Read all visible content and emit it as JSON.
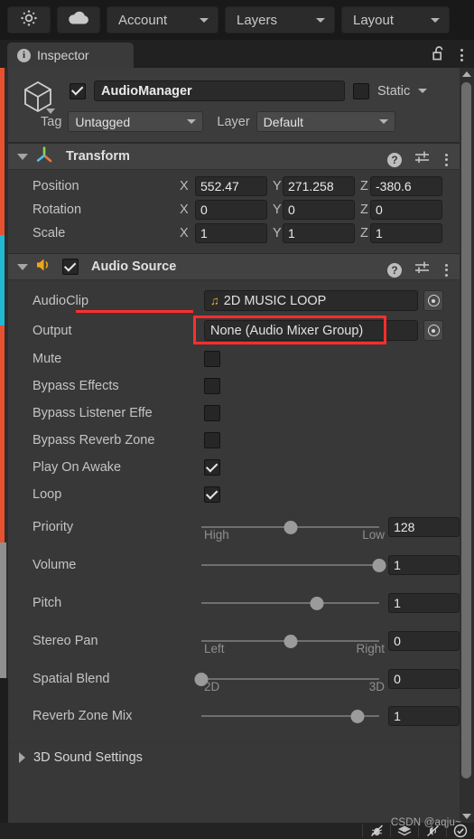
{
  "toolbar": {
    "icon_buttons": [
      {
        "name": "unity-effects-icon",
        "label": ""
      },
      {
        "name": "cloud-icon",
        "label": ""
      }
    ],
    "dropdowns": [
      {
        "label": "Account"
      },
      {
        "label": "Layers"
      },
      {
        "label": "Layout"
      }
    ]
  },
  "tab": {
    "label": "Inspector",
    "icon": "info-icon",
    "lock_icon": "unlocked-padlock-icon",
    "menu_icon": "kebab-menu-icon"
  },
  "object_header": {
    "icon": "gameobject-cube-icon",
    "enabled": true,
    "name": "AudioManager",
    "static_label": "Static",
    "static_checked": false,
    "tag_label": "Tag",
    "tag_value": "Untagged",
    "layer_label": "Layer",
    "layer_value": "Default"
  },
  "transform": {
    "title": "Transform",
    "icon": "transform-gizmo-icon",
    "expanded": true,
    "rows": [
      {
        "label": "Position",
        "x": "552.47",
        "y": "271.258",
        "z": "-380.6"
      },
      {
        "label": "Rotation",
        "x": "0",
        "y": "0",
        "z": "0"
      },
      {
        "label": "Scale",
        "x": "1",
        "y": "1",
        "z": "1"
      }
    ],
    "axes": [
      "X",
      "Y",
      "Z"
    ]
  },
  "audio_source": {
    "title": "Audio Source",
    "icon": "speaker-icon",
    "enabled": true,
    "expanded": true,
    "audio_clip": {
      "label": "AudioClip",
      "value": "2D MUSIC LOOP",
      "icon": "music-note-icon",
      "highlighted": true
    },
    "output": {
      "label": "Output",
      "value": "None (Audio Mixer Group)"
    },
    "toggles": [
      {
        "label": "Mute",
        "checked": false
      },
      {
        "label": "Bypass Effects",
        "checked": false
      },
      {
        "label": "Bypass Listener Effe",
        "checked": false
      },
      {
        "label": "Bypass Reverb Zone",
        "checked": false
      },
      {
        "label": "Play On Awake",
        "checked": true
      },
      {
        "label": "Loop",
        "checked": true
      }
    ],
    "sliders": [
      {
        "label": "Priority",
        "value": "128",
        "fill": 50,
        "min_label": "High",
        "max_label": "Low"
      },
      {
        "label": "Volume",
        "value": "1",
        "fill": 100,
        "min_label": "",
        "max_label": ""
      },
      {
        "label": "Pitch",
        "value": "1",
        "fill": 65,
        "min_label": "",
        "max_label": ""
      },
      {
        "label": "Stereo Pan",
        "value": "0",
        "fill": 50,
        "min_label": "Left",
        "max_label": "Right"
      },
      {
        "label": "Spatial Blend",
        "value": "0",
        "fill": 0,
        "min_label": "2D",
        "max_label": "3D"
      },
      {
        "label": "Reverb Zone Mix",
        "value": "1",
        "fill": 88,
        "min_label": "",
        "max_label": ""
      }
    ],
    "sound_settings": {
      "label": "3D Sound Settings",
      "expanded": false
    }
  },
  "status_bar": {
    "watermark": "CSDN @aqju~",
    "icons": [
      "bug-off-icon",
      "layers-icon",
      "mute-off-icon",
      "check-circle-icon"
    ]
  },
  "colors": {
    "accent_red": "#ff2f2f",
    "panel_bg": "#383838",
    "header_bg": "#424242",
    "clip_note": "#e8b62c"
  }
}
